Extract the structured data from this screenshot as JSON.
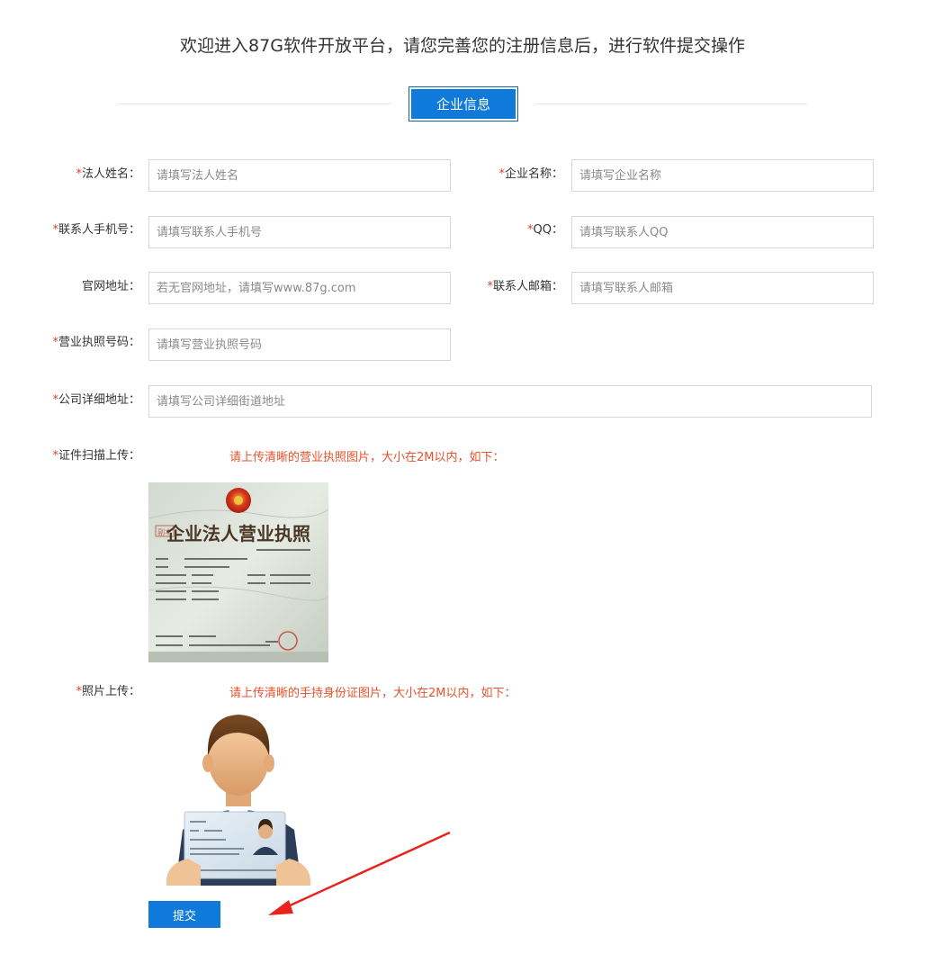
{
  "header": {
    "welcome": "欢迎进入87G软件开放平台，请您完善您的注册信息后，进行软件提交操作",
    "section_tab": "企业信息"
  },
  "form": {
    "legal_name": {
      "label": "法人姓名：",
      "placeholder": "请填写法人姓名",
      "required": true
    },
    "company_name": {
      "label": "企业名称：",
      "placeholder": "请填写企业名称",
      "required": true
    },
    "contact_phone": {
      "label": "联系人手机号：",
      "placeholder": "请填写联系人手机号",
      "required": true
    },
    "qq": {
      "label": "QQ：",
      "placeholder": "请填写联系人QQ",
      "required": true
    },
    "website": {
      "label": "官网地址：",
      "placeholder": "若无官网地址，请填写www.87g.com",
      "required": false
    },
    "contact_email": {
      "label": "联系人邮箱：",
      "placeholder": "请填写联系人邮箱",
      "required": true
    },
    "license_no": {
      "label": "营业执照号码：",
      "placeholder": "请填写营业执照号码",
      "required": true
    },
    "address": {
      "label": "公司详细地址：",
      "placeholder": "请填写公司详细街道地址",
      "required": true
    },
    "license_upload": {
      "label": "证件扫描上传：",
      "hint": "请上传清晰的营业执照图片，大小在2M以内，如下：",
      "required": true
    },
    "photo_upload": {
      "label": "照片上传：",
      "hint": "请上传清晰的手持身份证图片，大小在2M以内，如下：",
      "required": true
    },
    "required_mark": "*",
    "submit_label": "提交"
  },
  "license_sample": {
    "title": "企业法人营业执照",
    "badge": "副本"
  },
  "colors": {
    "primary": "#0f7ad9",
    "required": "#e53b32",
    "hint": "#e8512b",
    "arrow": "#e8231d"
  }
}
